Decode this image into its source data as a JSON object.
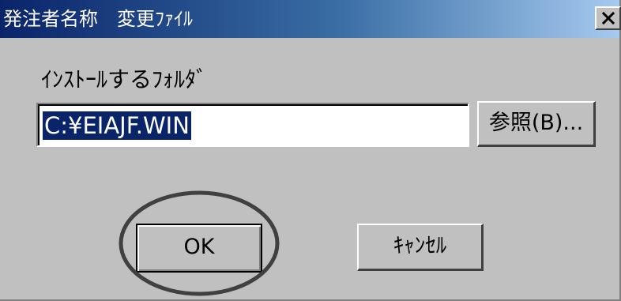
{
  "window": {
    "title": "発注者名称　変更ﾌｧｲﾙ",
    "close_icon": "close-icon"
  },
  "form": {
    "folder_label": "ｲﾝｽﾄｰﾙするﾌｫﾙﾀﾞ",
    "folder_value": "C:¥EIAJF.WIN",
    "browse_label": "参照(B)..."
  },
  "buttons": {
    "ok_label": "OK",
    "cancel_label": "ｷｬﾝｾﾙ"
  },
  "colors": {
    "titlebar_start": "#0a246a",
    "titlebar_end": "#a6caf0",
    "face": "#c0c0c0",
    "selection": "#0a246a",
    "annotation": "#404040"
  }
}
